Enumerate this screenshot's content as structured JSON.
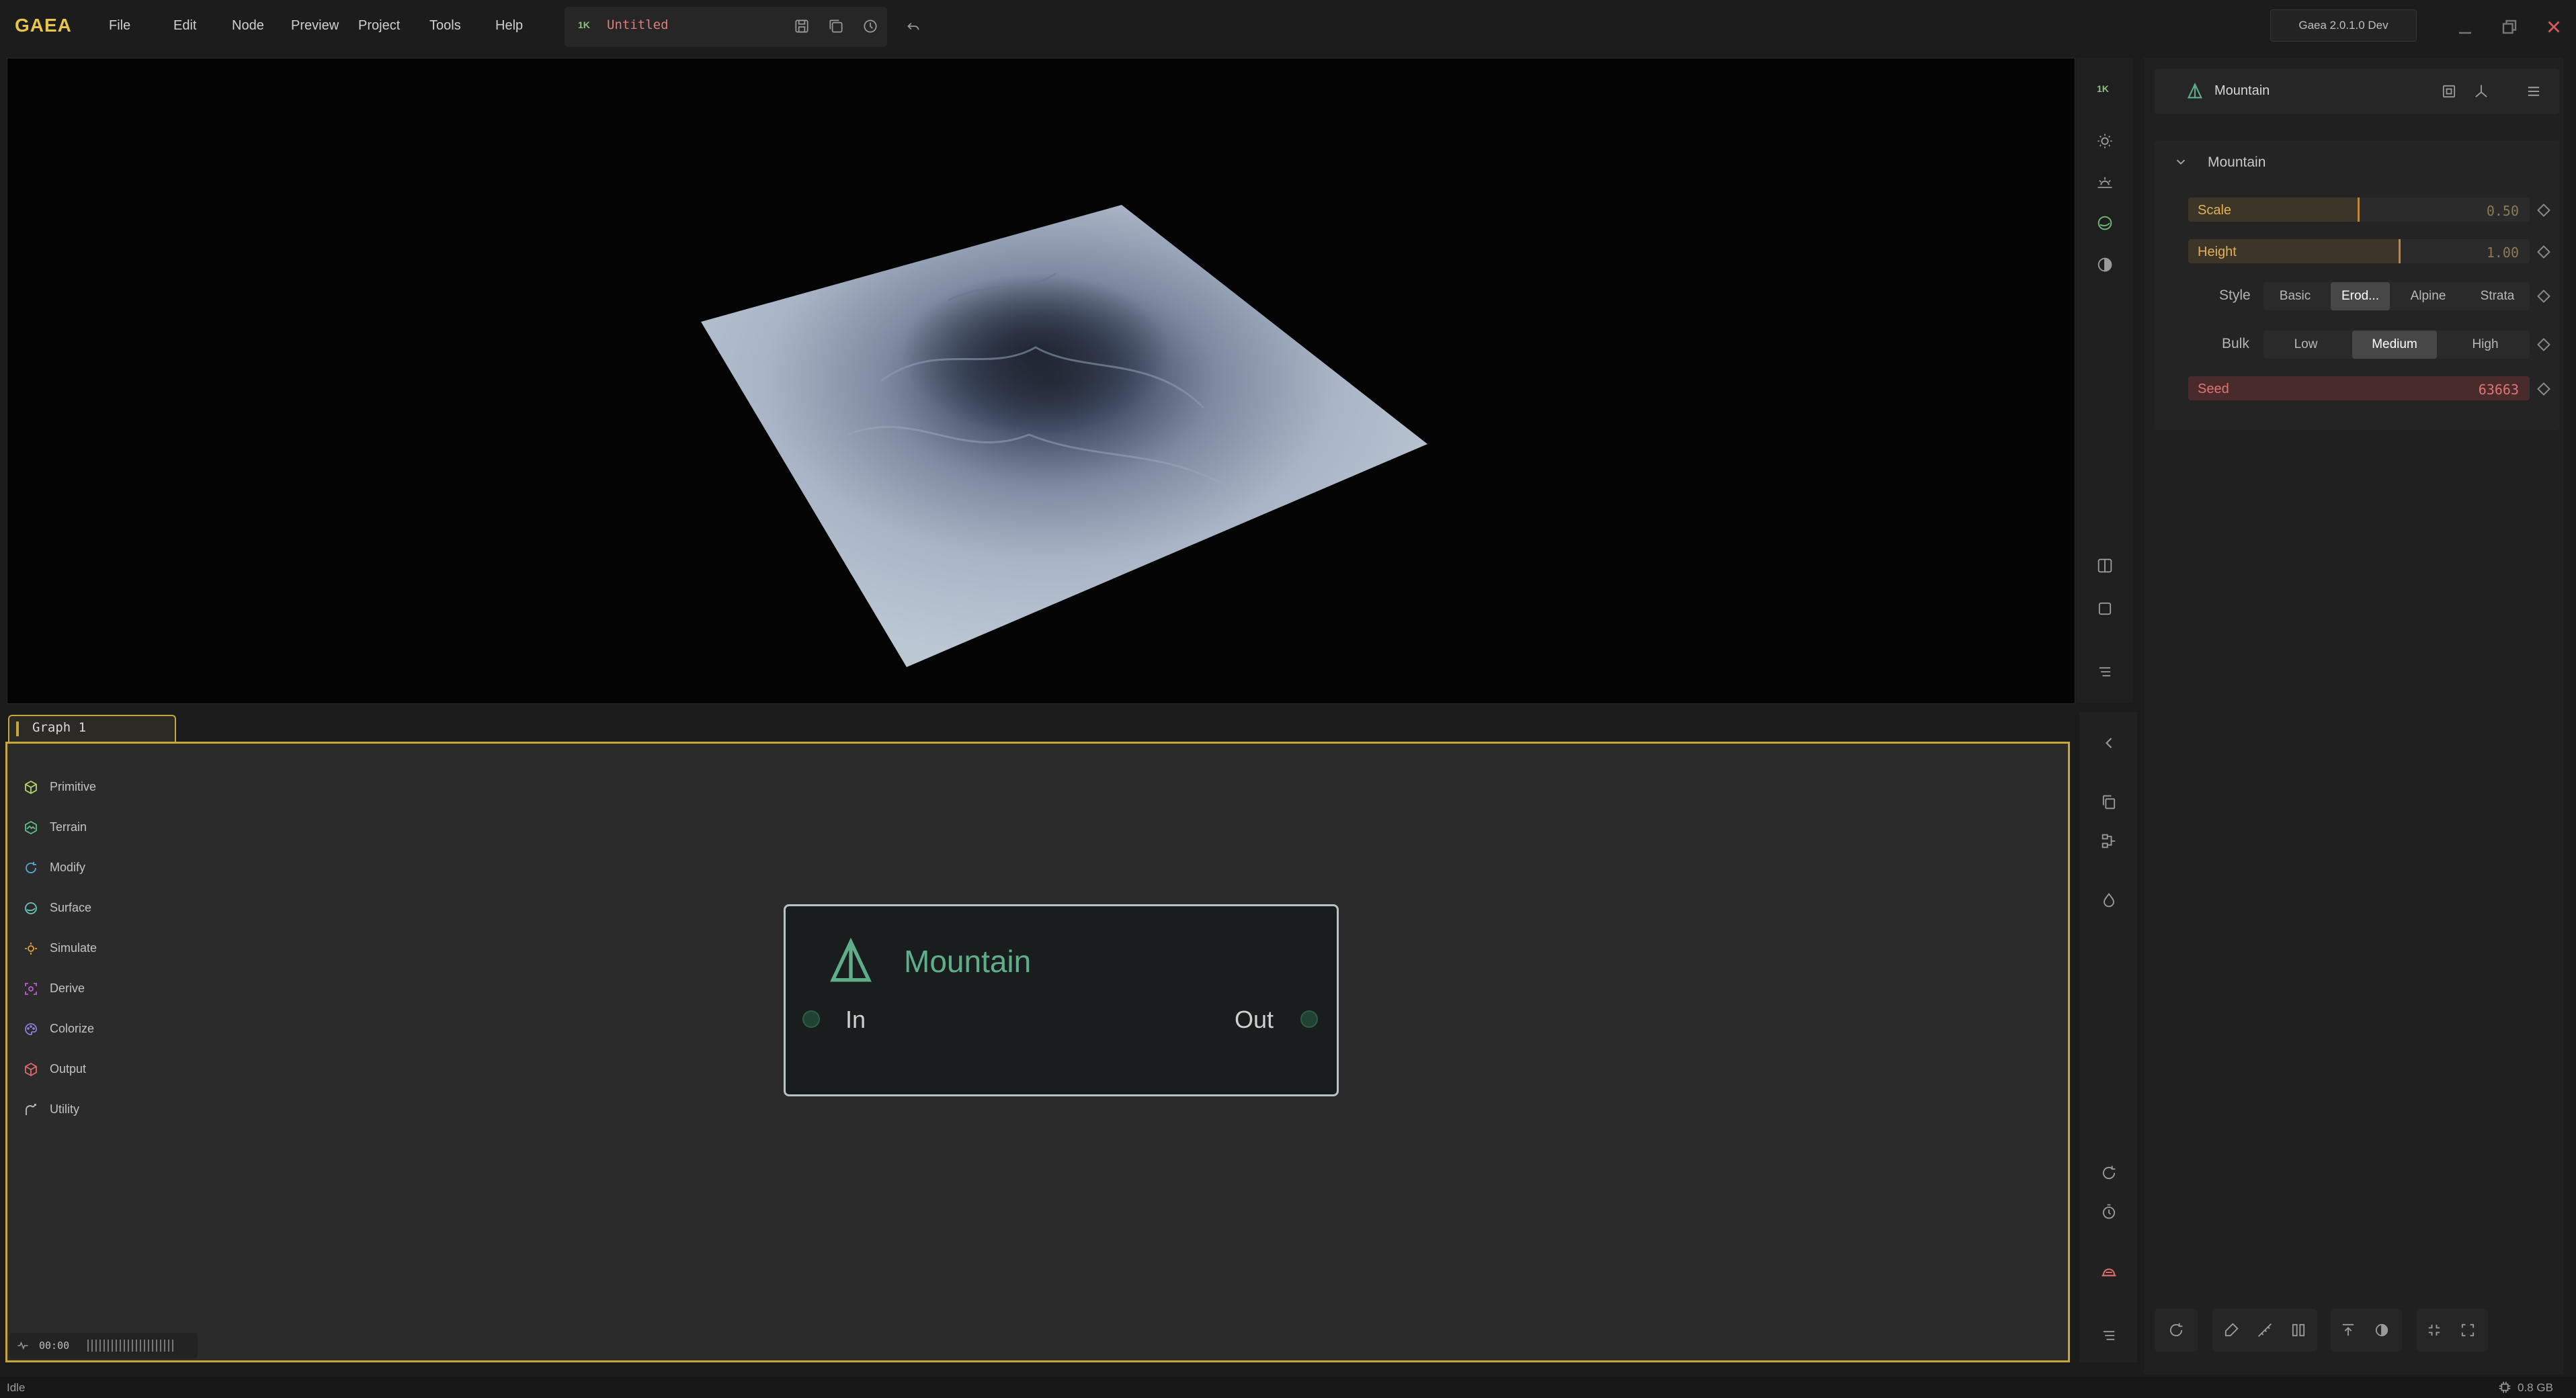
{
  "app": {
    "logo": "GAEA",
    "version": "Gaea 2.0.1.0 Dev"
  },
  "menu": [
    "File",
    "Edit",
    "Node",
    "Preview",
    "Project",
    "Tools",
    "Help"
  ],
  "file": {
    "resolution": "1K",
    "name": "Untitled"
  },
  "viewport": {
    "toolbar_badge": "1K"
  },
  "properties": {
    "node_name": "Mountain",
    "section_title": "Mountain",
    "scale": {
      "label": "Scale",
      "value": "0.50",
      "level": 0.5
    },
    "height": {
      "label": "Height",
      "value": "1.00",
      "level": 0.62
    },
    "style": {
      "label": "Style",
      "options": [
        "Basic",
        "Erod...",
        "Alpine",
        "Strata"
      ],
      "selected": "Erod..."
    },
    "bulk": {
      "label": "Bulk",
      "options": [
        "Low",
        "Medium",
        "High"
      ],
      "selected": "Medium"
    },
    "seed": {
      "label": "Seed",
      "value": "63663"
    }
  },
  "graph": {
    "tab_label": "Graph 1",
    "categories": [
      {
        "label": "Primitive",
        "color": "#b7d46b"
      },
      {
        "label": "Terrain",
        "color": "#5fbf8c"
      },
      {
        "label": "Modify",
        "color": "#5aa9d6"
      },
      {
        "label": "Surface",
        "color": "#6ac7b7"
      },
      {
        "label": "Simulate",
        "color": "#e3a13f"
      },
      {
        "label": "Derive",
        "color": "#c05bd1"
      },
      {
        "label": "Colorize",
        "color": "#8c7ed8"
      },
      {
        "label": "Output",
        "color": "#e06a6a"
      },
      {
        "label": "Utility",
        "color": "#bdbdbd"
      }
    ],
    "node": {
      "title": "Mountain",
      "input": "In",
      "output": "Out",
      "accent": "#5fae8a"
    },
    "timeline_time": "00:00"
  },
  "status": {
    "text": "Idle",
    "memory": "0.8 GB"
  }
}
